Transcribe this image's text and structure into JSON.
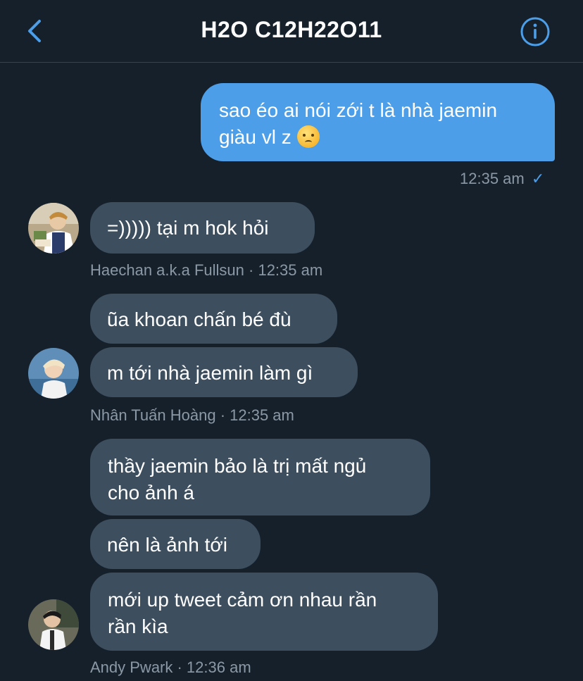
{
  "header": {
    "title": "H2O C12H22O11",
    "back_icon": "chevron-left-icon",
    "info_icon": "info-icon",
    "accent": "#4c9ee9"
  },
  "messages": {
    "m1": {
      "line1": "sao éo ai nói zới t là nhà jaemin",
      "line2": "giàu vl z",
      "emoji": "🥲",
      "time": "12:35 am",
      "status": "✓"
    },
    "m2": {
      "text": "=))))) tại m hok hỏi",
      "sender": "Haechan a.k.a Fullsun · 12:35 am"
    },
    "m3": {
      "text": "ũa khoan chấn bé đù"
    },
    "m4": {
      "text": "m tới nhà jaemin làm gì",
      "sender": "Nhân Tuấn Hoàng · 12:35 am"
    },
    "m5": {
      "line1": "thầy jaemin bảo là trị mất ngủ",
      "line2": "cho ảnh á"
    },
    "m6": {
      "text": "nên là ảnh tới"
    },
    "m7": {
      "line1": "mới up tweet cảm ơn nhau rần",
      "line2": "rần kìa",
      "sender": "Andy Pwark · 12:36 am"
    }
  }
}
